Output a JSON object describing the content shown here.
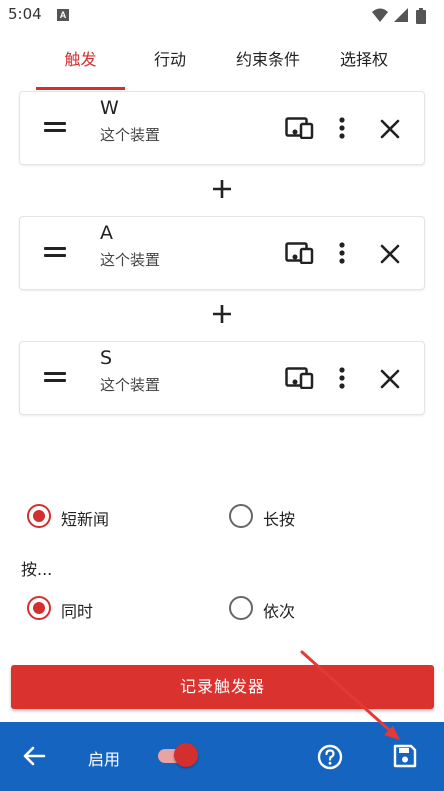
{
  "status_bar": {
    "time": "5:04",
    "app_icon_letter": "A",
    "icons": [
      "wifi-icon",
      "signal-icon",
      "battery-icon"
    ]
  },
  "tabs": [
    {
      "label": "触发",
      "active": true
    },
    {
      "label": "行动",
      "active": false
    },
    {
      "label": "约束条件",
      "active": false
    },
    {
      "label": "选择权",
      "active": false
    }
  ],
  "trigger_keys": [
    {
      "key": "W",
      "device": "这个装置"
    },
    {
      "key": "A",
      "device": "这个装置"
    },
    {
      "key": "S",
      "device": "这个装置"
    }
  ],
  "key_separator": "+",
  "click_type": {
    "options": [
      {
        "label": "短新闻",
        "checked": true
      },
      {
        "label": "长按",
        "checked": false
      }
    ]
  },
  "press_mode": {
    "label": "按...",
    "options": [
      {
        "label": "同时",
        "checked": true
      },
      {
        "label": "依次",
        "checked": false
      }
    ]
  },
  "record_button": {
    "label": "记录触发器"
  },
  "bottom_bar": {
    "enable_label": "启用",
    "enabled": true,
    "icons": [
      "back-arrow-icon",
      "help-icon",
      "save-icon"
    ]
  },
  "colors": {
    "accent": "#d32f2f",
    "bottom_bar": "#1565c0",
    "record_button": "#d9322f"
  }
}
